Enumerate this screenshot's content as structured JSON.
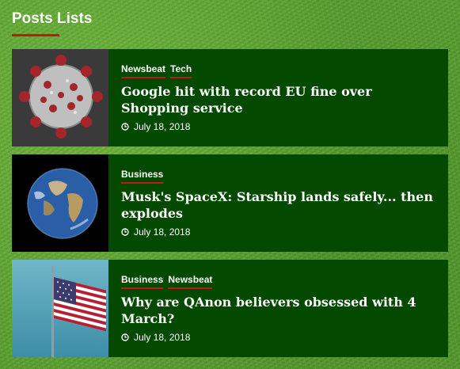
{
  "section": {
    "title": "Posts Lists",
    "accent": "#c4161c"
  },
  "posts": [
    {
      "thumbnail": "coronavirus-image",
      "categories": [
        "Newsbeat",
        "Tech"
      ],
      "title": "Google hit with record EU fine over Shopping service",
      "date": "July 18, 2018"
    },
    {
      "thumbnail": "earth-image",
      "categories": [
        "Business"
      ],
      "title": "Musk's SpaceX: Starship lands safely... then explodes",
      "date": "July 18, 2018"
    },
    {
      "thumbnail": "us-flag-image",
      "categories": [
        "Business",
        "Newsbeat"
      ],
      "title": "Why are QAnon believers obsessed with 4 March?",
      "date": "July 18, 2018"
    }
  ],
  "colors": {
    "card_bg": "#034a00",
    "text": "#ffffff"
  }
}
